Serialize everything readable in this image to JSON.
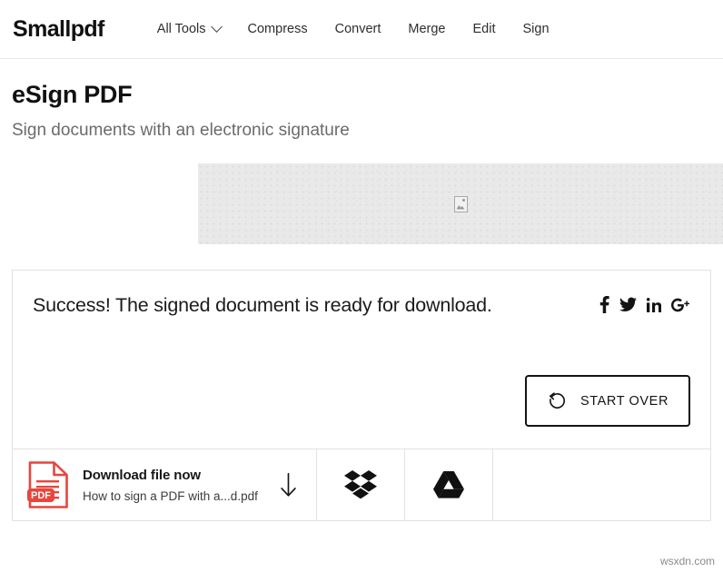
{
  "header": {
    "brand": "Smallpdf",
    "nav": [
      {
        "label": "All Tools",
        "has_chevron": true
      },
      {
        "label": "Compress",
        "has_chevron": false
      },
      {
        "label": "Convert",
        "has_chevron": false
      },
      {
        "label": "Merge",
        "has_chevron": false
      },
      {
        "label": "Edit",
        "has_chevron": false
      },
      {
        "label": "Sign",
        "has_chevron": false
      }
    ]
  },
  "page": {
    "title": "eSign PDF",
    "subtitle": "Sign documents with an electronic signature"
  },
  "banner": {
    "icon": "broken-image-icon",
    "background_color": "#e9e9e9"
  },
  "result": {
    "success_message": "Success! The signed document is ready for download.",
    "share": [
      {
        "name": "facebook-icon",
        "label": "f"
      },
      {
        "name": "twitter-icon",
        "label": "Twitter"
      },
      {
        "name": "linkedin-icon",
        "label": "in"
      },
      {
        "name": "googleplus-icon",
        "label": "G+"
      }
    ],
    "start_over_label": "START OVER",
    "start_over_icon": "rotate-left-icon",
    "download": {
      "title": "Download file now",
      "filename": "How to sign a PDF with a...d.pdf",
      "file_type_badge": "PDF",
      "file_icon_color": "#E8453C",
      "arrow_icon": "arrow-down-icon"
    },
    "cloud_targets": [
      {
        "name": "dropbox-icon",
        "label": "Dropbox"
      },
      {
        "name": "google-drive-icon",
        "label": "Google Drive"
      }
    ]
  },
  "watermark": "wsxdn.com"
}
